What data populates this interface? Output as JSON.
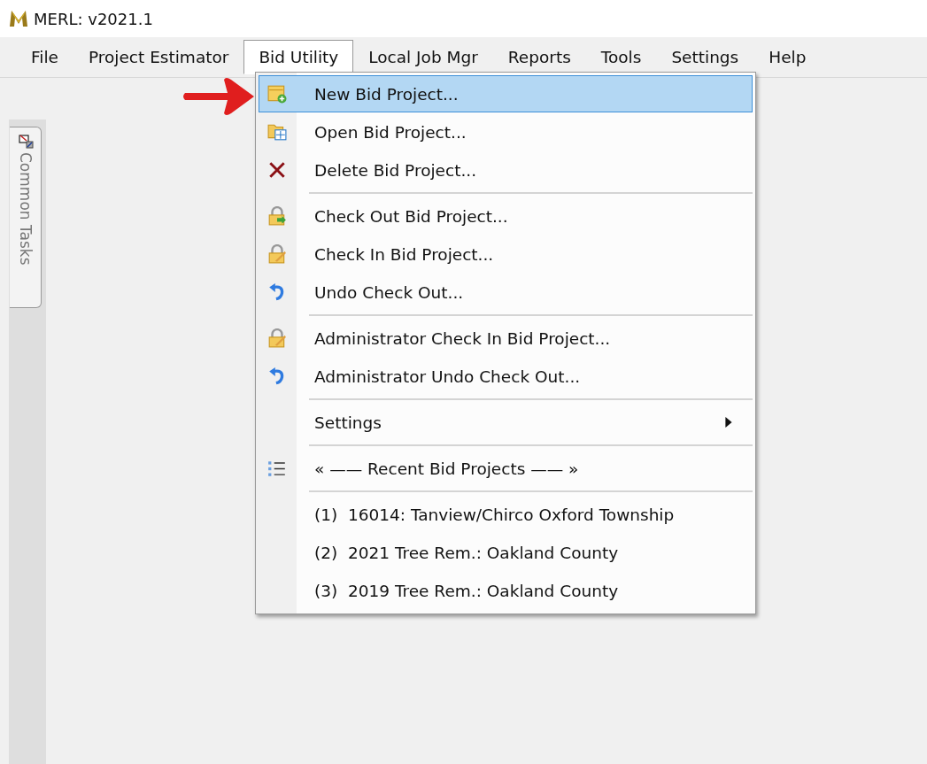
{
  "window": {
    "title": "MERL: v2021.1"
  },
  "menubar": [
    {
      "label": "File",
      "selected": false
    },
    {
      "label": "Project Estimator",
      "selected": false
    },
    {
      "label": "Bid Utility",
      "selected": true
    },
    {
      "label": "Local Job Mgr",
      "selected": false
    },
    {
      "label": "Reports",
      "selected": false
    },
    {
      "label": "Tools",
      "selected": false
    },
    {
      "label": "Settings",
      "selected": false
    },
    {
      "label": "Help",
      "selected": false
    }
  ],
  "side_tab": {
    "label": "Common Tasks"
  },
  "menu": [
    {
      "kind": "item",
      "label": "New Bid Project...",
      "selected": true
    },
    {
      "kind": "item",
      "label": "Open Bid Project...",
      "selected": false
    },
    {
      "kind": "item",
      "label": "Delete Bid Project...",
      "selected": false
    },
    {
      "kind": "separator"
    },
    {
      "kind": "item",
      "label": "Check Out Bid Project...",
      "selected": false
    },
    {
      "kind": "item",
      "label": "Check In Bid Project...",
      "selected": false
    },
    {
      "kind": "item",
      "label": "Undo Check Out...",
      "selected": false
    },
    {
      "kind": "separator"
    },
    {
      "kind": "item",
      "label": "Administrator Check In Bid Project...",
      "selected": false
    },
    {
      "kind": "item",
      "label": "Administrator Undo Check Out...",
      "selected": false
    },
    {
      "kind": "separator"
    },
    {
      "kind": "submenu",
      "label": "Settings",
      "selected": false
    },
    {
      "kind": "separator"
    },
    {
      "kind": "header",
      "label": "« —— Recent Bid Projects —— »",
      "selected": false
    },
    {
      "kind": "separator"
    },
    {
      "kind": "item",
      "label": "(1)  16014: Tanview/Chirco Oxford Township",
      "selected": false
    },
    {
      "kind": "item",
      "label": "(2)  2021 Tree Rem.: Oakland County",
      "selected": false
    },
    {
      "kind": "item",
      "label": "(3)  2019 Tree Rem.: Oakland County",
      "selected": false
    }
  ]
}
